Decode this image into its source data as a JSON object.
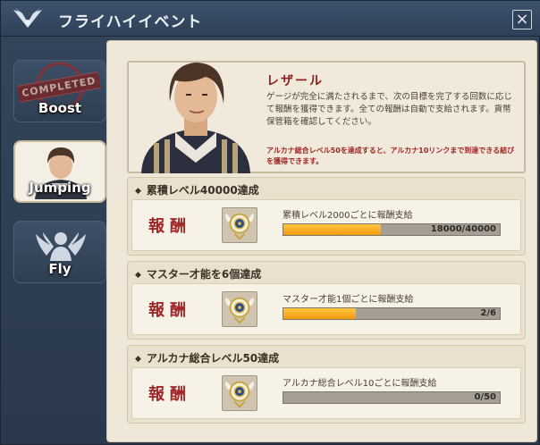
{
  "window": {
    "title": "フライハイイベント"
  },
  "tabs": [
    {
      "label": "Boost",
      "stamp": "COMPLETED"
    },
    {
      "label": "Jumping",
      "active": true
    },
    {
      "label": "Fly"
    }
  ],
  "intro": {
    "name": "レザール",
    "desc": "ゲージが完全に満たされるまで、次の目標を完了する回数に応じて報酬を獲得できます。全ての報酬は自動で支給されます。貨幣保管箱を確認してください。",
    "note": "アルカナ総合レベル50を達成すると、アルカナ10リンクまで到達できる結びを獲得できます。"
  },
  "goals": [
    {
      "title": "累積レベル40000達成",
      "reward_label": "報酬",
      "progress_label": "累積レベル2000ごとに報酬支給",
      "progress_text": "18000/40000",
      "progress": 0.45
    },
    {
      "title": "マスター才能を6個達成",
      "reward_label": "報酬",
      "progress_label": "マスター才能1個ごとに報酬支給",
      "progress_text": "2/6",
      "progress": 0.3333
    },
    {
      "title": "アルカナ総合レベル50達成",
      "reward_label": "報酬",
      "progress_label": "アルカナ総合レベル10ごとに報酬支給",
      "progress_text": "0/50",
      "progress": 0
    }
  ],
  "colors": {
    "accent_red": "#a0282a",
    "progress_orange": "#f29a0e",
    "panel": "#efe7d7"
  },
  "icons": {
    "title": "wings-logo-icon",
    "close": "close-icon",
    "reward": "reward-emblem-icon",
    "fly_tab": "winged-person-icon"
  }
}
